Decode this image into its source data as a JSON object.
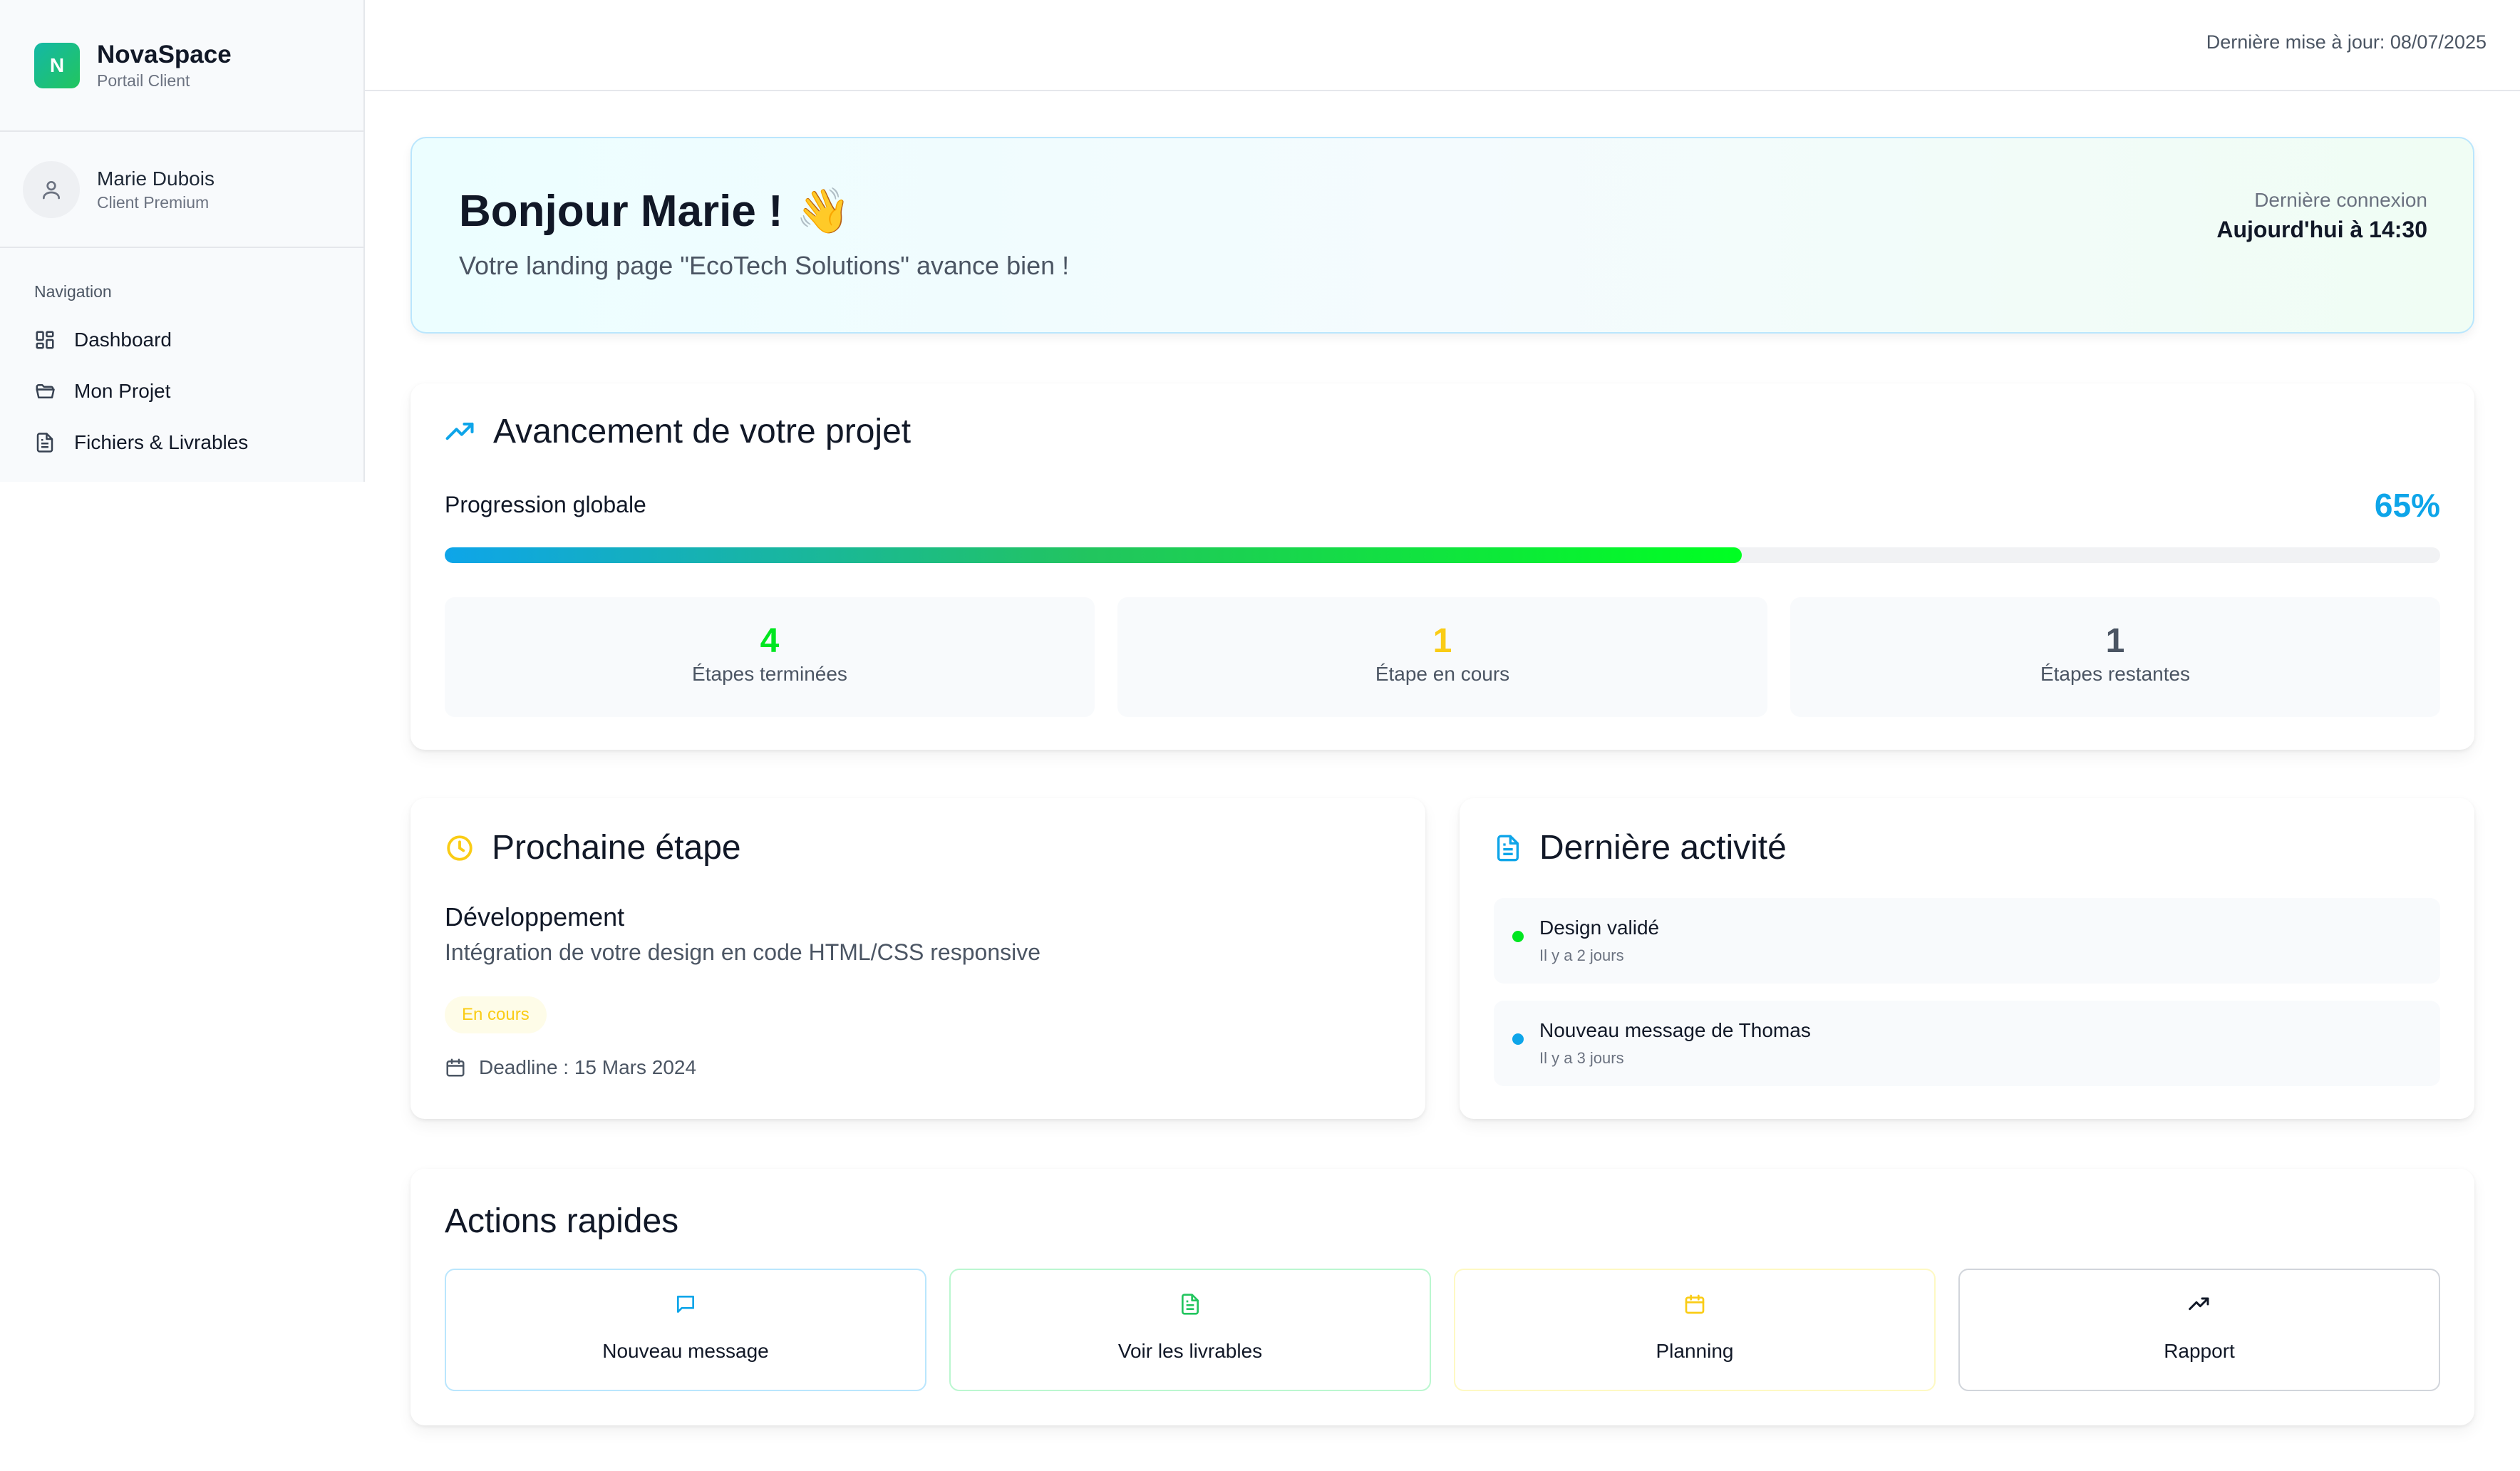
{
  "brand": {
    "name": "NovaSpace",
    "subtitle": "Portail Client",
    "logo_letter": "N"
  },
  "user": {
    "name": "Marie Dubois",
    "role": "Client Premium"
  },
  "nav": {
    "title": "Navigation",
    "items": [
      {
        "label": "Dashboard",
        "icon": "grid-icon"
      },
      {
        "label": "Mon Projet",
        "icon": "folder-icon"
      },
      {
        "label": "Fichiers & Livrables",
        "icon": "file-icon"
      }
    ]
  },
  "topbar": {
    "updated": "Dernière mise à jour: 08/07/2025"
  },
  "welcome": {
    "greeting": "Bonjour Marie !",
    "emoji": "👋",
    "subtitle": "Votre landing page \"EcoTech Solutions\" avance bien !",
    "last_login_label": "Dernière connexion",
    "last_login_value": "Aujourd'hui à 14:30"
  },
  "progress": {
    "title": "Avancement de votre projet",
    "label": "Progression globale",
    "percent_text": "65%",
    "fraction": 0.65,
    "stats": [
      {
        "value": "4",
        "label": "Étapes terminées",
        "color": "#00e620"
      },
      {
        "value": "1",
        "label": "Étape en cours",
        "color": "#facc15"
      },
      {
        "value": "1",
        "label": "Étapes restantes",
        "color": "#4b5563"
      }
    ]
  },
  "next_step": {
    "title": "Prochaine étape",
    "step_title": "Développement",
    "step_desc": "Intégration de votre design en code HTML/CSS responsive",
    "badge": "En cours",
    "deadline": "Deadline : 15 Mars 2024"
  },
  "activity": {
    "title": "Dernière activité",
    "items": [
      {
        "title": "Design validé",
        "time": "Il y a 2 jours",
        "color": "#00e620"
      },
      {
        "title": "Nouveau message de Thomas",
        "time": "Il y a 3 jours",
        "color": "#0ea5e9"
      }
    ]
  },
  "quick_actions": {
    "title": "Actions rapides",
    "items": [
      {
        "label": "Nouveau message",
        "icon": "message-icon",
        "color": "#0ea5e9",
        "border": "#bae6fd"
      },
      {
        "label": "Voir les livrables",
        "icon": "file-icon",
        "color": "#22c55e",
        "border": "#bbf7d0"
      },
      {
        "label": "Planning",
        "icon": "calendar-icon",
        "color": "#facc15",
        "border": "#fef9c3"
      },
      {
        "label": "Rapport",
        "icon": "trending-icon",
        "color": "#111827",
        "border": "#d1d5db"
      }
    ]
  }
}
